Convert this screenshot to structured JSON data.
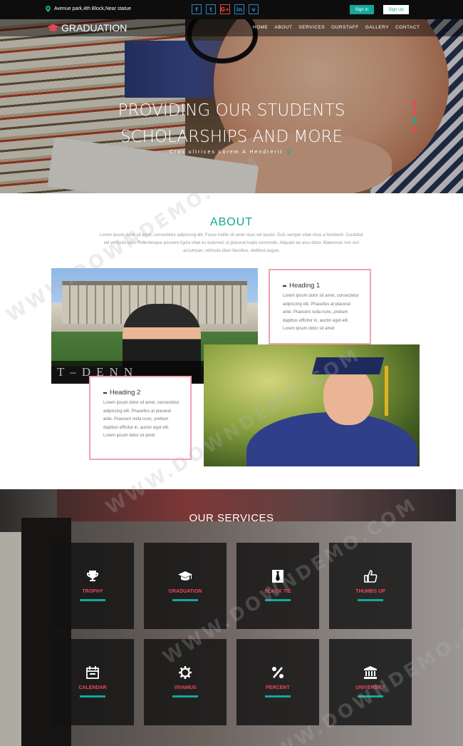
{
  "topbar": {
    "address": "Avenue park,4th Block,Near statue",
    "social": [
      "f",
      "t",
      "G+",
      "in",
      "v"
    ],
    "signin_label": "Sign In",
    "signup_label": "Sign Up"
  },
  "nav": {
    "logo": "GRADUATION",
    "items": [
      "HOME",
      "ABOUT",
      "SERVICES",
      "OURSTAFF",
      "GALLERY",
      "CONTACT"
    ]
  },
  "hero": {
    "title_line1": "PROVIDING OUR STUDENTS",
    "title_line2": "SCHOLARSHIPS AND MORE",
    "subtitle": "Cras ultrices Lorem A Hendrerit"
  },
  "about": {
    "title": "ABOUT",
    "text": "Lorem ipsum dolor sit amet, consectetur adipiscing elit. Fusce mollis sit amet risus vel iaculis. Duis semper vitae risus a hendrerit. Curabitur vel vehicula odio. Pellentesque posuere ligula vitae ex euismod, ut placerat turpis commodo. Aliquam eu arcu dolor. Maecenas non orci accumsan, vehicula diam faucibus, eleifend augue.",
    "photo_word": "T–DENN",
    "card1": {
      "heading": "Heading 1",
      "text": "Lorem ipsum dolor sit amet, consectetur adipiscing elit. Phasellus at placerat ante. Praesent nulla nunc, pretium dapibus efficitur in, auctor eget elit. Lorem ipsum dolor sit amet"
    },
    "card2": {
      "heading": "Heading 2",
      "text": "Lorem ipsum dolor sit amet, consectetur adipiscing elit. Phasellus at placerat ante. Praesent nulla nunc, pretium dapibus efficitur in, auctor eget elit. Lorem ipsum dolor sit amet"
    }
  },
  "services": {
    "title": "OUR SERVICES",
    "items": [
      {
        "label": "TROPHY",
        "icon": "trophy-icon"
      },
      {
        "label": "GRADUATION",
        "icon": "graduation-cap-icon"
      },
      {
        "label": "BLACK TIE",
        "icon": "black-tie-icon"
      },
      {
        "label": "THUMBS UP",
        "icon": "thumbs-up-icon"
      },
      {
        "label": "CALENDAR",
        "icon": "calendar-icon"
      },
      {
        "label": "VIVAMUS",
        "icon": "gear-icon"
      },
      {
        "label": "PERCENT",
        "icon": "percent-icon"
      },
      {
        "label": "UNIVERSITY",
        "icon": "university-icon"
      }
    ]
  },
  "watermark": "WWW.DOWNDEMO.COM",
  "colors": {
    "accent": "#14a89b",
    "pink": "#e9475c"
  }
}
